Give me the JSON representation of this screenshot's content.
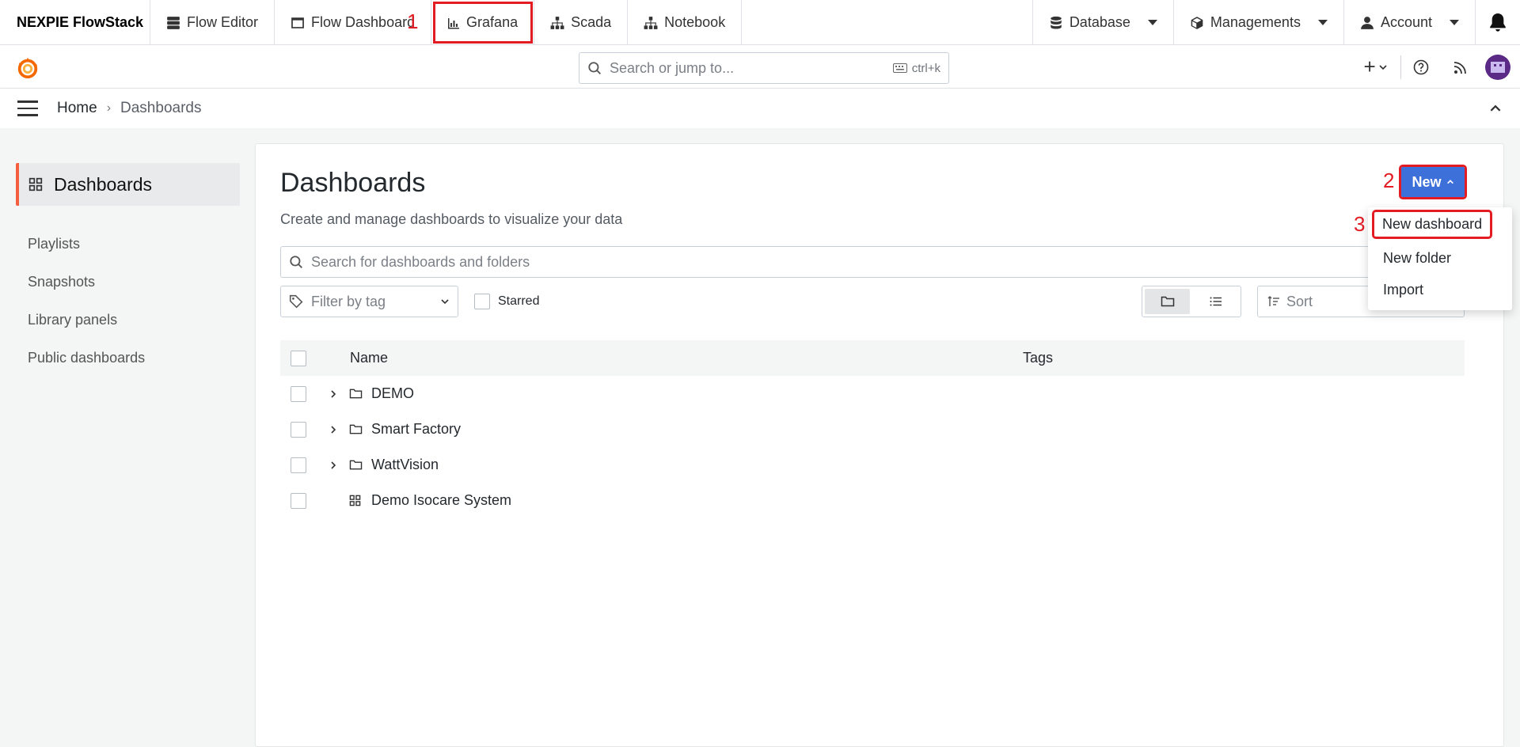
{
  "topnav": {
    "brand": "NEXPIE FlowStack",
    "items": [
      {
        "label": "Flow Editor",
        "icon": "server-icon"
      },
      {
        "label": "Flow Dashboard",
        "icon": "dashboard-icon"
      },
      {
        "label": "Grafana",
        "icon": "chart-bar-icon"
      },
      {
        "label": "Scada",
        "icon": "sitemap-icon"
      },
      {
        "label": "Notebook",
        "icon": "sitemap-icon"
      }
    ],
    "right": [
      {
        "label": "Database",
        "icon": "database-icon"
      },
      {
        "label": "Managements",
        "icon": "cube-icon"
      },
      {
        "label": "Account",
        "icon": "user-icon"
      }
    ]
  },
  "annotations": {
    "a1": "1",
    "a2": "2",
    "a3": "3"
  },
  "grafana": {
    "search_placeholder": "Search or jump to...",
    "shortcut": "ctrl+k"
  },
  "breadcrumb": {
    "home": "Home",
    "separator": "›",
    "current": "Dashboards"
  },
  "sidebar": {
    "active": "Dashboards",
    "items": [
      "Playlists",
      "Snapshots",
      "Library panels",
      "Public dashboards"
    ]
  },
  "page": {
    "title": "Dashboards",
    "subtitle": "Create and manage dashboards to visualize your data",
    "new_button": "New",
    "search_placeholder": "Search for dashboards and folders",
    "tag_filter": "Filter by tag",
    "starred": "Starred",
    "sort": "Sort"
  },
  "table": {
    "columns": {
      "name": "Name",
      "tags": "Tags"
    },
    "rows": [
      {
        "name": "DEMO",
        "type": "folder"
      },
      {
        "name": "Smart Factory",
        "type": "folder"
      },
      {
        "name": "WattVision",
        "type": "folder"
      },
      {
        "name": "Demo Isocare System",
        "type": "dashboard"
      }
    ]
  },
  "new_menu": {
    "items": [
      "New dashboard",
      "New folder",
      "Import"
    ]
  },
  "colors": {
    "accent": "#3d71d9",
    "highlight": "#e31b23",
    "active_bar": "#f55f3e"
  }
}
